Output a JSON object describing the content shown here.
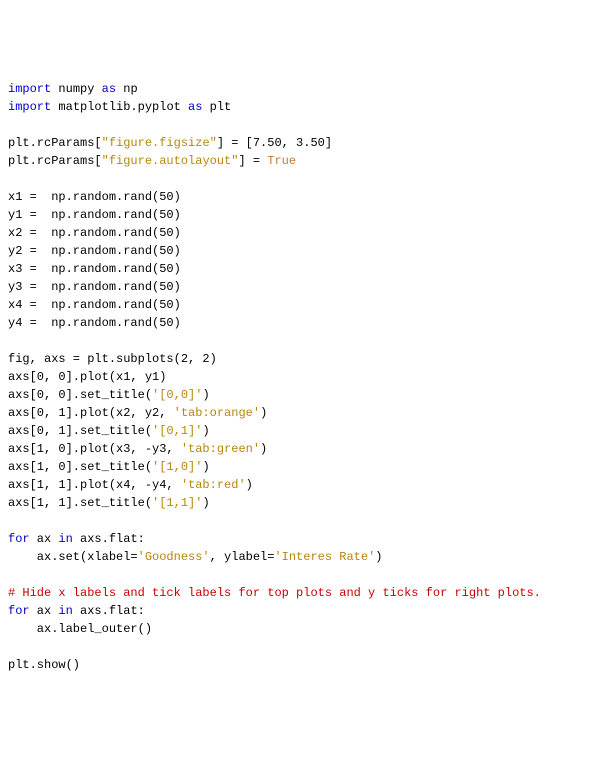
{
  "lines": {
    "l01a": "import",
    "l01b": " numpy ",
    "l01c": "as",
    "l01d": " np",
    "l02a": "import",
    "l02b": " matplotlib.pyplot ",
    "l02c": "as",
    "l02d": " plt",
    "l04a": "plt.rcParams[",
    "l04b": "\"figure.figsize\"",
    "l04c": "] = [7.50, 3.50]",
    "l05a": "plt.rcParams[",
    "l05b": "\"figure.autolayout\"",
    "l05c": "] = ",
    "l05d": "True",
    "l07": "x1 =  np.random.rand(50)",
    "l08": "y1 =  np.random.rand(50)",
    "l09": "x2 =  np.random.rand(50)",
    "l10": "y2 =  np.random.rand(50)",
    "l11": "x3 =  np.random.rand(50)",
    "l12": "y3 =  np.random.rand(50)",
    "l13": "x4 =  np.random.rand(50)",
    "l14": "y4 =  np.random.rand(50)",
    "l16": "fig, axs = plt.subplots(2, 2)",
    "l17": "axs[0, 0].plot(x1, y1)",
    "l18a": "axs[0, 0].set_title(",
    "l18b": "'[0,0]'",
    "l18c": ")",
    "l19a": "axs[0, 1].plot(x2, y2, ",
    "l19b": "'tab:orange'",
    "l19c": ")",
    "l20a": "axs[0, 1].set_title(",
    "l20b": "'[0,1]'",
    "l20c": ")",
    "l21a": "axs[1, 0].plot(x3, -y3, ",
    "l21b": "'tab:green'",
    "l21c": ")",
    "l22a": "axs[1, 0].set_title(",
    "l22b": "'[1,0]'",
    "l22c": ")",
    "l23a": "axs[1, 1].plot(x4, -y4, ",
    "l23b": "'tab:red'",
    "l23c": ")",
    "l24a": "axs[1, 1].set_title(",
    "l24b": "'[1,1]'",
    "l24c": ")",
    "l26a": "for",
    "l26b": " ax ",
    "l26c": "in",
    "l26d": " axs.flat:",
    "l27a": "    ax.set(xlabel=",
    "l27b": "'Goodness'",
    "l27c": ", ylabel=",
    "l27d": "'Interes Rate'",
    "l27e": ")",
    "l29": "# Hide x labels and tick labels for top plots and y ticks for right plots.",
    "l30a": "for",
    "l30b": " ax ",
    "l30c": "in",
    "l30d": " axs.flat:",
    "l31": "    ax.label_outer()",
    "l33": "plt.show()"
  }
}
